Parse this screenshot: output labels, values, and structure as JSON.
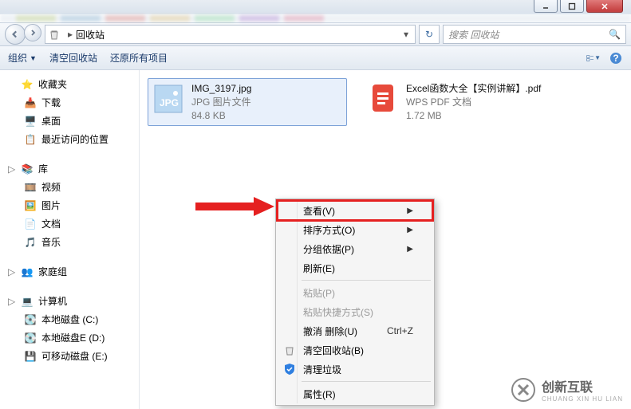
{
  "breadcrumb": {
    "location": "回收站"
  },
  "search": {
    "placeholder": "搜索 回收站"
  },
  "toolbar": {
    "organize": "组织",
    "empty": "清空回收站",
    "restore_all": "还原所有项目"
  },
  "sidebar": {
    "favorites": {
      "label": "收藏夹",
      "items": [
        "下载",
        "桌面",
        "最近访问的位置"
      ]
    },
    "libraries": {
      "label": "库",
      "items": [
        "视频",
        "图片",
        "文档",
        "音乐"
      ]
    },
    "homegroup": {
      "label": "家庭组"
    },
    "computer": {
      "label": "计算机",
      "items": [
        "本地磁盘 (C:)",
        "本地磁盘E (D:)",
        "可移动磁盘 (E:)"
      ]
    }
  },
  "files": [
    {
      "name": "IMG_3197.jpg",
      "type": "JPG 图片文件",
      "size": "84.8 KB",
      "selected": true,
      "icon": "jpg"
    },
    {
      "name": "Excel函数大全【实例讲解】.pdf",
      "type": "WPS PDF 文档",
      "size": "1.72 MB",
      "selected": false,
      "icon": "pdf"
    }
  ],
  "context_menu": {
    "items": [
      {
        "label": "查看(V)",
        "submenu": true,
        "highlighted": true
      },
      {
        "label": "排序方式(O)",
        "submenu": true
      },
      {
        "label": "分组依据(P)",
        "submenu": true
      },
      {
        "label": "刷新(E)"
      },
      {
        "sep": true
      },
      {
        "label": "粘贴(P)",
        "disabled": true
      },
      {
        "label": "粘贴快捷方式(S)",
        "disabled": true
      },
      {
        "label": "撤消 删除(U)",
        "shortcut": "Ctrl+Z"
      },
      {
        "label": "清空回收站(B)",
        "icon": "recycle"
      },
      {
        "label": "清理垃圾",
        "icon": "shield"
      },
      {
        "sep": true
      },
      {
        "label": "属性(R)"
      }
    ]
  },
  "watermark": {
    "brand": "创新互联",
    "sub": "CHUANG XIN HU LIAN"
  }
}
